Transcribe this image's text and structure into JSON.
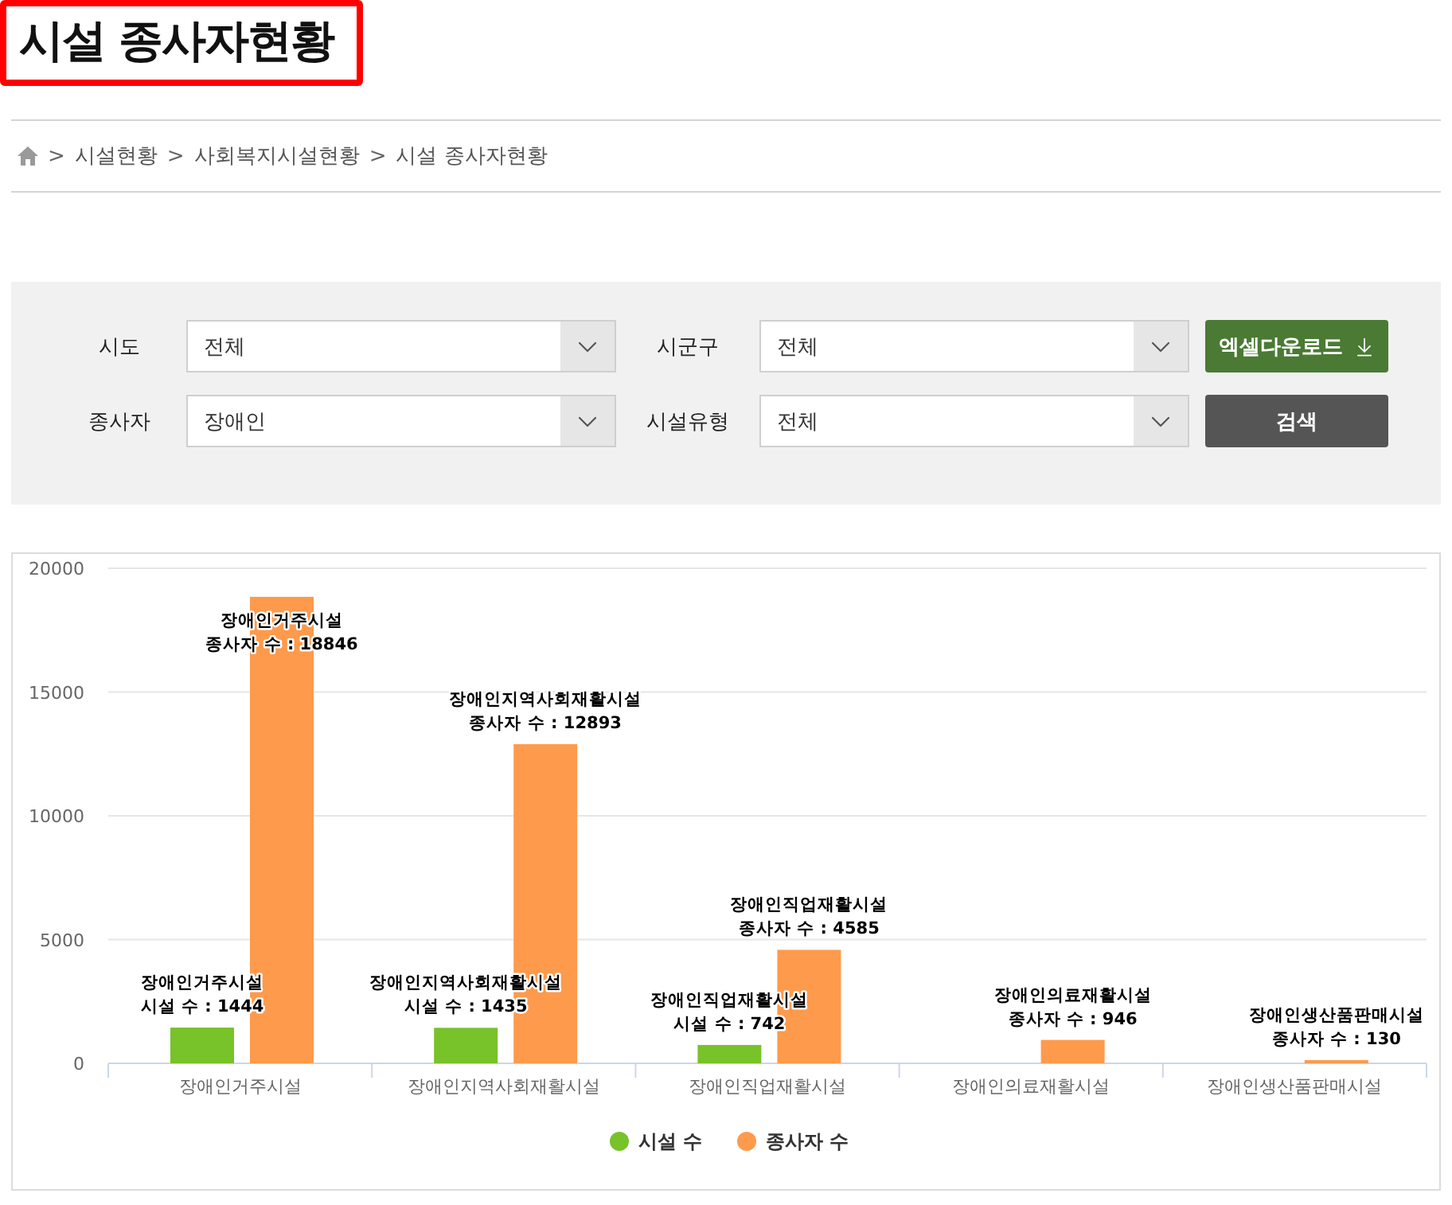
{
  "page_title": {
    "text": "시설 종사자현황",
    "highlighted": true
  },
  "breadcrumb": {
    "separator": ">",
    "items": [
      "시설현황",
      "사회복지시설현황",
      "시설 종사자현황"
    ]
  },
  "filters": [
    {
      "label": "시도",
      "value": "전체"
    },
    {
      "label": "시군구",
      "value": "전체"
    },
    {
      "label": "종사자",
      "value": "장애인"
    },
    {
      "label": "시설유형",
      "value": "전체"
    }
  ],
  "buttons": [
    {
      "kind": "download",
      "label": "엑셀다운로드"
    },
    {
      "kind": "search",
      "label": "검색"
    }
  ],
  "chart": {
    "chart_data": {
      "type": "bar",
      "categories": [
        "장애인거주시설",
        "장애인지역사회재활시설",
        "장애인직업재활시설",
        "장애인의료재활시설",
        "장애인생산품판매시설"
      ],
      "grid": "y",
      "legend": "bottom",
      "ylim": [
        0,
        20000
      ],
      "yticks": [
        0,
        5000,
        10000,
        15000,
        20000
      ],
      "series": [
        {
          "name": "시설 수",
          "color": "#78c22a",
          "values": [
            1444,
            1435,
            742,
            null,
            null
          ],
          "value_labels": [
            "장애인거주시설\n시설 수 : 1444",
            "장애인지역사회재활시설\n시설 수 : 1435",
            "장애인직업재활시설\n시설 수 : 742",
            null,
            null
          ]
        },
        {
          "name": "종사자 수",
          "color": "#fe9a4c",
          "values": [
            18846,
            12893,
            4585,
            946,
            130
          ],
          "value_labels": [
            "장애인거주시설\n종사자 수 : 18846",
            "장애인지역사회재활시설\n종사자 수 : 12893",
            "장애인직업재활시설\n종사자 수 : 4585",
            "장애인의료재활시설\n종사자 수 : 946",
            "장애인생산품판매시설\n종사자 수 : 130"
          ]
        }
      ]
    }
  }
}
